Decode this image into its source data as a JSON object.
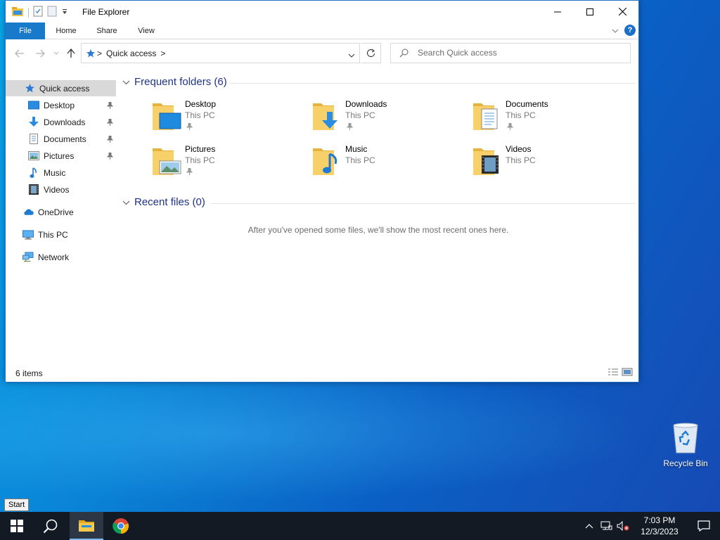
{
  "window": {
    "title": "File Explorer",
    "ribbon_tabs": [
      "File",
      "Home",
      "Share",
      "View"
    ],
    "help_label": "?"
  },
  "address": {
    "location": "Quick access",
    "separator": ">",
    "search_placeholder": "Search Quick access"
  },
  "nav_pane": {
    "quick_access": "Quick access",
    "pinned": [
      {
        "label": "Desktop",
        "icon": "desktop-icon"
      },
      {
        "label": "Downloads",
        "icon": "downloads-icon"
      },
      {
        "label": "Documents",
        "icon": "documents-icon"
      },
      {
        "label": "Pictures",
        "icon": "pictures-icon"
      },
      {
        "label": "Music",
        "icon": "music-icon"
      },
      {
        "label": "Videos",
        "icon": "videos-icon"
      }
    ],
    "onedrive": "OneDrive",
    "this_pc": "This PC",
    "network": "Network"
  },
  "content": {
    "frequent_header": "Frequent folders (6)",
    "folders": [
      {
        "name": "Desktop",
        "location": "This PC",
        "icon": "desktop-folder-icon"
      },
      {
        "name": "Downloads",
        "location": "This PC",
        "icon": "downloads-folder-icon"
      },
      {
        "name": "Documents",
        "location": "This PC",
        "icon": "documents-folder-icon"
      },
      {
        "name": "Pictures",
        "location": "This PC",
        "icon": "pictures-folder-icon"
      },
      {
        "name": "Music",
        "location": "This PC",
        "icon": "music-folder-icon"
      },
      {
        "name": "Videos",
        "location": "This PC",
        "icon": "videos-folder-icon"
      }
    ],
    "recent_header": "Recent files (0)",
    "recent_empty": "After you've opened some files, we'll show the most recent ones here."
  },
  "status": {
    "item_count": "6 items"
  },
  "desktop": {
    "recycle_bin": "Recycle Bin",
    "tooltip": "Start"
  },
  "taskbar": {
    "time": "7:03 PM",
    "date": "12/3/2023"
  },
  "colors": {
    "accent": "#1979ca",
    "selection": "#cce0f5",
    "group_header": "#1e3287",
    "taskbar": "#131a24"
  }
}
